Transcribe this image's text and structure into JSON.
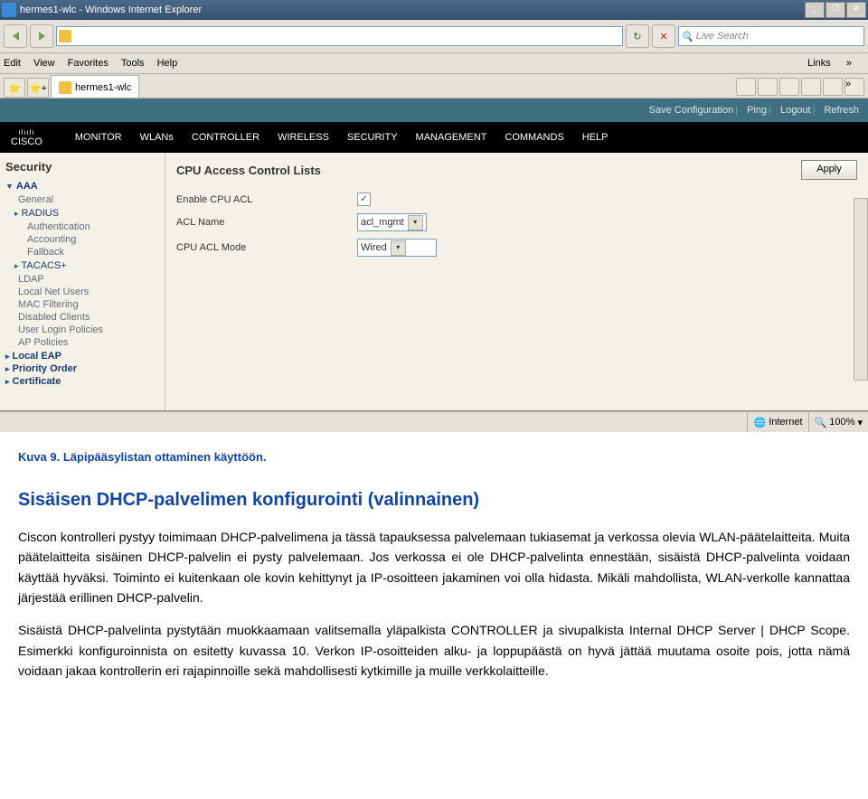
{
  "ie": {
    "title": "hermes1-wlc - Windows Internet Explorer",
    "search_placeholder": "Live Search",
    "menus": [
      "Edit",
      "View",
      "Favorites",
      "Tools",
      "Help"
    ],
    "links_label": "Links",
    "tab_title": "hermes1-wlc"
  },
  "cisco_top": {
    "items": [
      "Save Configuration",
      "Ping",
      "Logout",
      "Refresh"
    ]
  },
  "cisco_logo": "CISCO",
  "nav": [
    "MONITOR",
    "WLANs",
    "CONTROLLER",
    "WIRELESS",
    "SECURITY",
    "MANAGEMENT",
    "COMMANDS",
    "HELP"
  ],
  "sidebar": {
    "title": "Security",
    "aaa": "AAA",
    "aaa_items": [
      "General",
      "RADIUS",
      "Authentication",
      "Accounting",
      "Fallback",
      "TACACS+",
      "LDAP",
      "Local Net Users",
      "MAC Filtering",
      "Disabled Clients",
      "User Login Policies",
      "AP Policies"
    ],
    "nodes": [
      "Local EAP",
      "Priority Order",
      "Certificate"
    ]
  },
  "page": {
    "title": "CPU Access Control Lists",
    "apply": "Apply",
    "row1_label": "Enable CPU ACL",
    "row1_checked": true,
    "row2_label": "ACL Name",
    "row2_value": "acl_mgmt",
    "row3_label": "CPU ACL Mode",
    "row3_value": "Wired"
  },
  "status": {
    "zone": "Internet",
    "zoom": "100%"
  },
  "doc": {
    "caption": "Kuva 9. Läpipääsylistan ottaminen käyttöön.",
    "heading": "Sisäisen DHCP-palvelimen konfigurointi (valinnainen)",
    "p1": "Ciscon kontrolleri pystyy toimimaan DHCP-palvelimena ja tässä tapauksessa palvelemaan tukiasemat ja verkossa olevia WLAN-päätelaitteita. Muita päätelaitteita sisäinen DHCP-palvelin ei pysty palvelemaan. Jos verkossa ei ole DHCP-palvelinta ennestään, sisäistä DHCP-palvelinta voidaan käyttää hyväksi. Toiminto ei kuitenkaan ole kovin kehittynyt ja IP-osoitteen jakaminen voi olla hidasta. Mikäli mahdollista, WLAN-verkolle kannattaa järjestää erillinen DHCP-palvelin.",
    "p2": "Sisäistä DHCP-palvelinta pystytään muokkaamaan valitsemalla yläpalkista CONTROLLER ja sivupalkista Internal DHCP Server | DHCP Scope. Esimerkki konfiguroinnista on esitetty kuvassa 10. Verkon IP-osoitteiden alku- ja loppupäästä on hyvä jättää muutama osoite pois, jotta nämä voidaan jakaa kontrollerin eri rajapinnoille sekä mahdollisesti kytkimille ja muille verkkolaitteille."
  }
}
